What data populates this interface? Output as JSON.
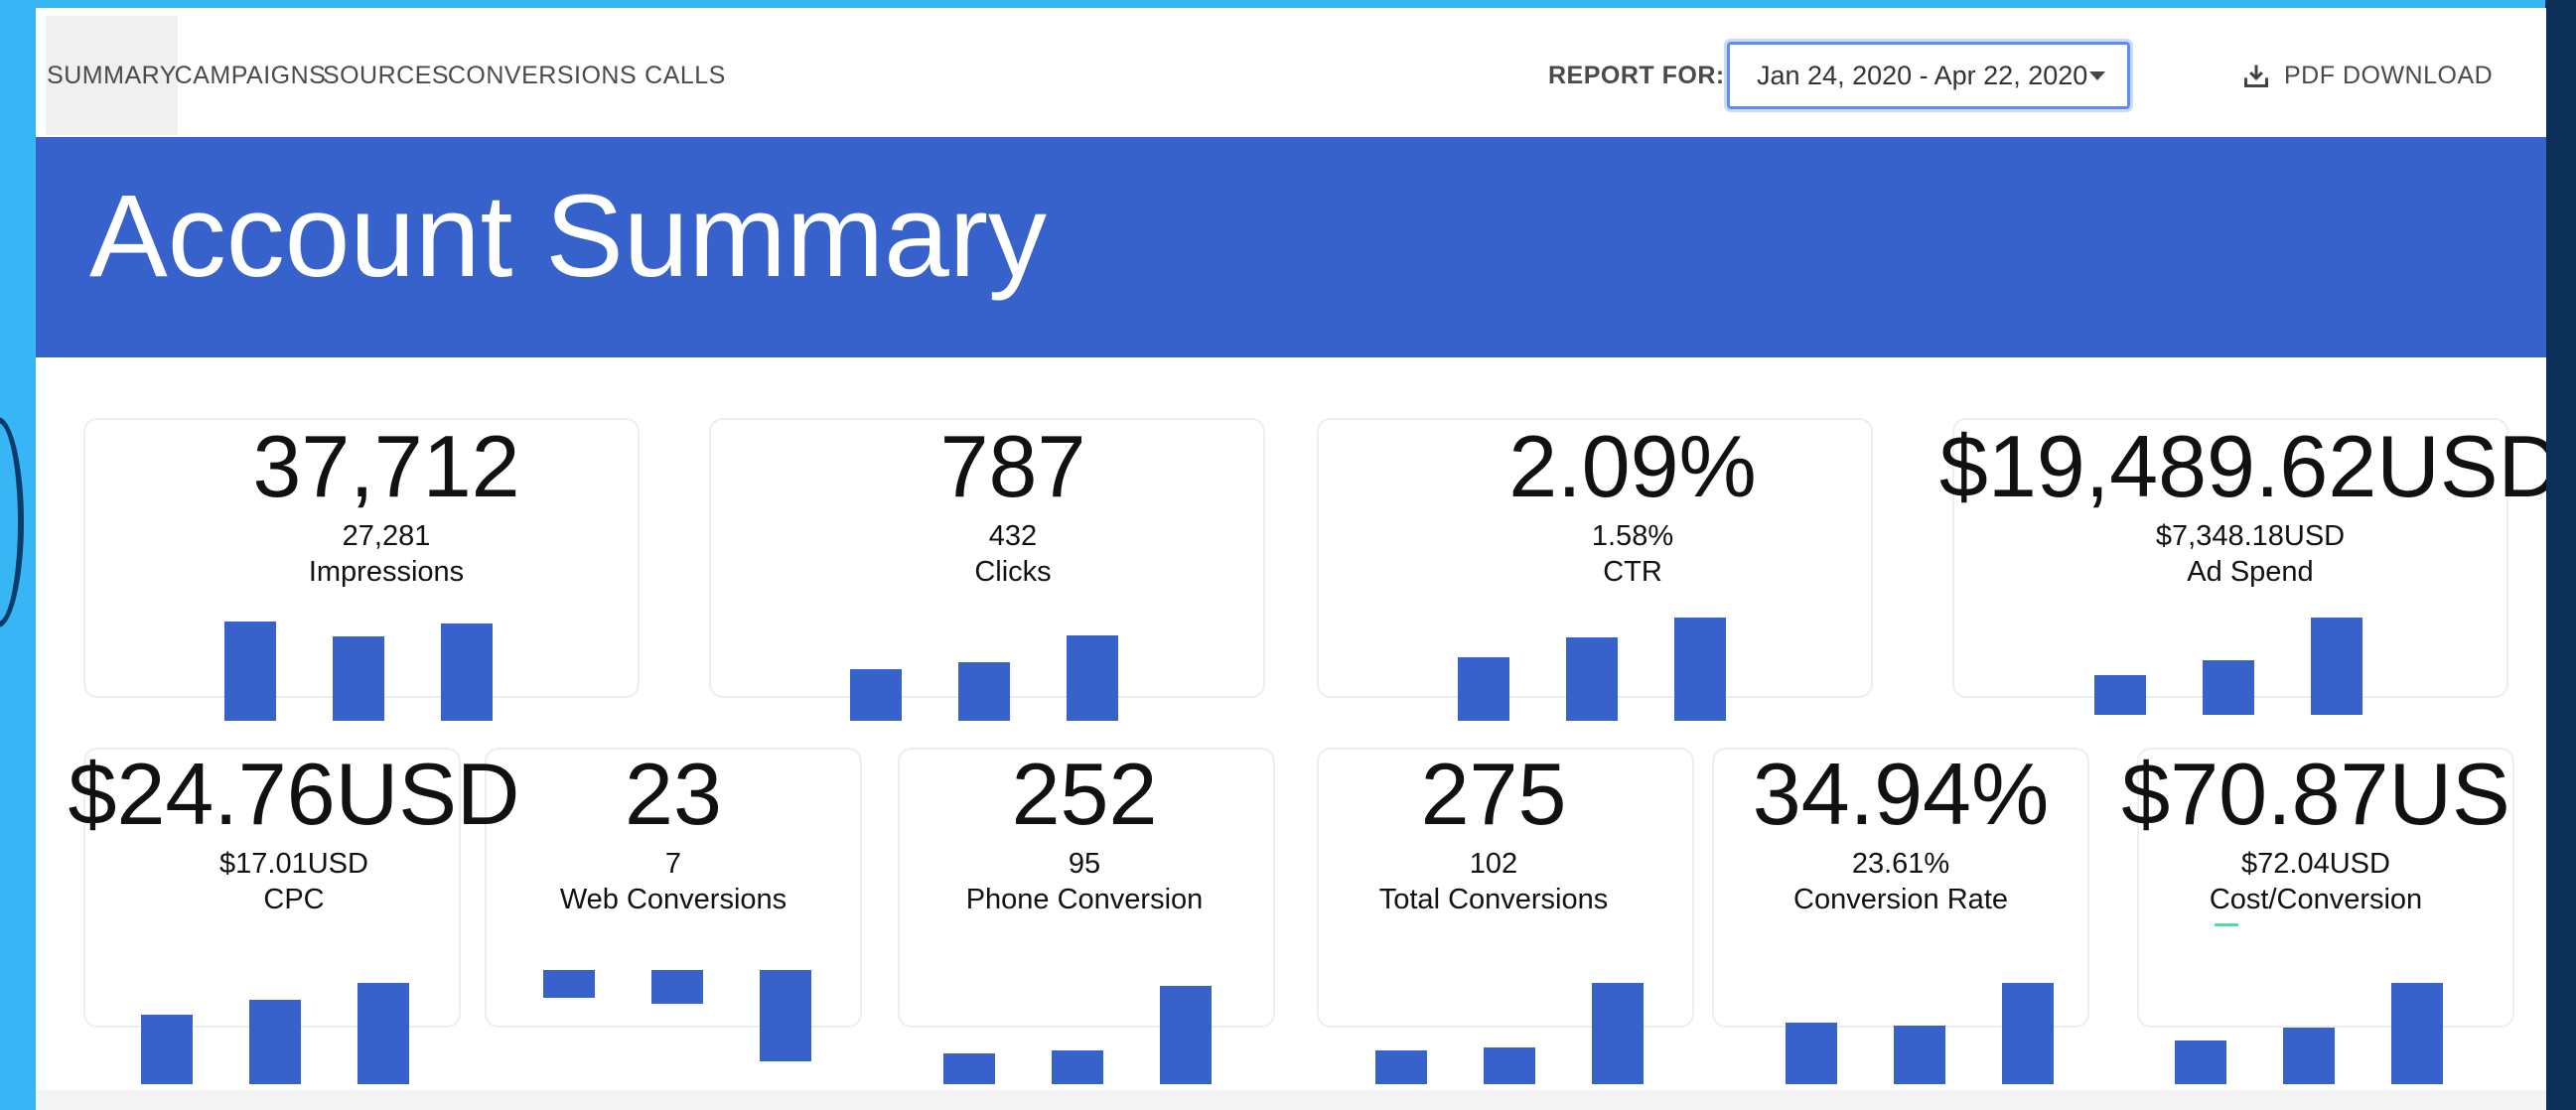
{
  "nav": {
    "tabs": [
      "SUMMARY",
      "CAMPAIGNS",
      "SOURCES",
      "CONVERSIONS",
      "CALLS"
    ],
    "active_tab": "SUMMARY",
    "report_for_label": "REPORT FOR:",
    "date_range": "Jan 24, 2020 - Apr 22, 2020",
    "pdf_download": "PDF DOWNLOAD",
    "pdf_icon": "download-icon"
  },
  "page_title": "Account Summary",
  "metrics": [
    {
      "id": "impressions",
      "value": "37,712",
      "previous": "27,281",
      "label": "Impressions"
    },
    {
      "id": "clicks",
      "value": "787",
      "previous": "432",
      "label": "Clicks"
    },
    {
      "id": "ctr",
      "value": "2.09%",
      "previous": "1.58%",
      "label": "CTR"
    },
    {
      "id": "ad-spend",
      "value": "$19,489.62USD",
      "previous": "$7,348.18USD",
      "label": "Ad Spend"
    },
    {
      "id": "cpc",
      "value": "$24.76USD",
      "previous": "$17.01USD",
      "label": "CPC"
    },
    {
      "id": "web-conversions",
      "value": "23",
      "previous": "7",
      "label": "Web Conversions"
    },
    {
      "id": "phone-conversion",
      "value": "252",
      "previous": "95",
      "label": "Phone Conversion"
    },
    {
      "id": "total-conversions",
      "value": "275",
      "previous": "102",
      "label": "Total Conversions"
    },
    {
      "id": "conversion-rate",
      "value": "34.94%",
      "previous": "23.61%",
      "label": "Conversion Rate"
    },
    {
      "id": "cost-conversion",
      "value": "$70.87US",
      "previous": "$72.04USD",
      "label": "Cost/Conversion"
    }
  ],
  "colors": {
    "accent": "#3762cc",
    "background": "#38b5f5",
    "highlight": "#52d9a8"
  }
}
